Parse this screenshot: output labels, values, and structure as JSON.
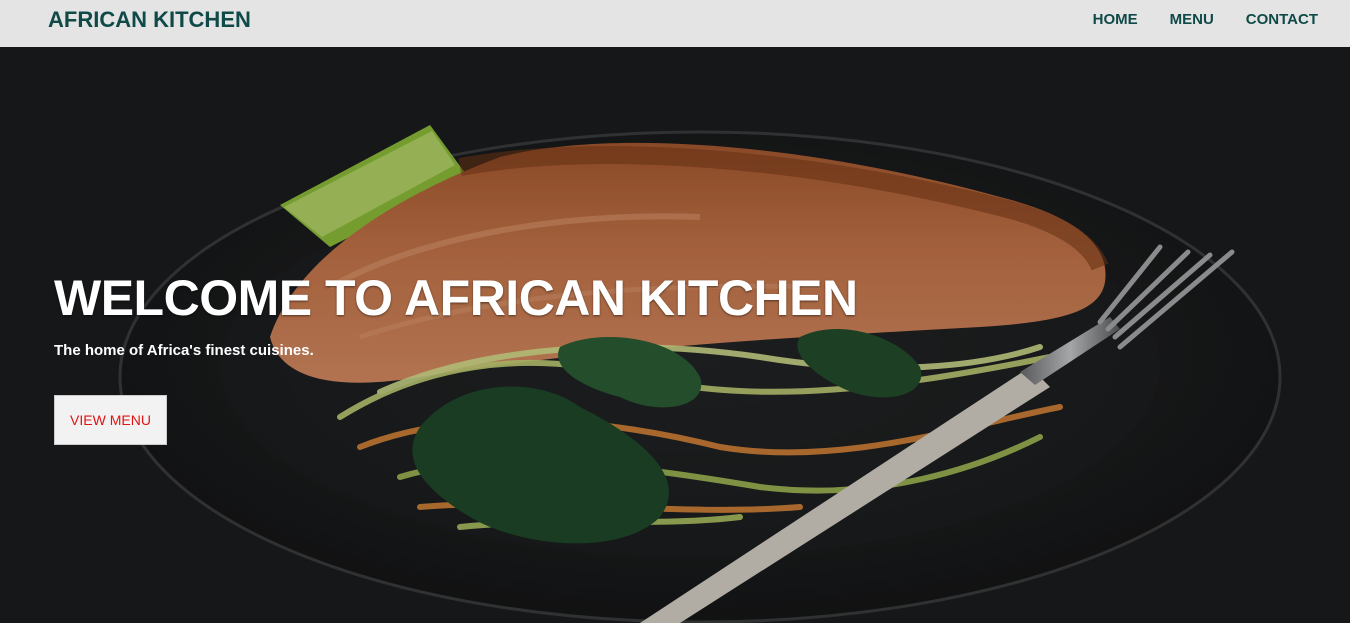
{
  "navbar": {
    "brand": "AFRICAN KITCHEN",
    "links": [
      "HOME",
      "MENU",
      "CONTACT"
    ]
  },
  "hero": {
    "title": "WELCOME TO AFRICAN KITCHEN",
    "subtitle": "The home of Africa's finest cuisines.",
    "button_label": "VIEW MENU",
    "image": "grilled-salmon-with-vegetable-noodles-and-fork"
  },
  "colors": {
    "navbar_bg": "#e4e4e4",
    "brand_color": "#0f4a48",
    "button_text": "#e01414",
    "button_bg": "#f2f2f2",
    "hero_text": "#ffffff"
  }
}
